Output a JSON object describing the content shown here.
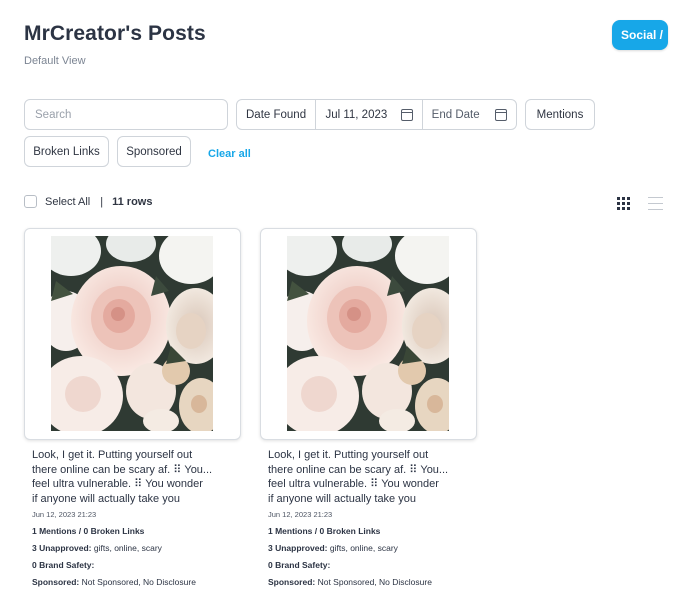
{
  "header": {
    "title": "MrCreator's Posts",
    "subtitle": "Default View",
    "social_button": "Social /"
  },
  "filters": {
    "search_placeholder": "Search",
    "date_found_label": "Date Found",
    "start_date": "Jul 11, 2023",
    "end_date_placeholder": "End Date",
    "mentions": "Mentions",
    "broken_links": "Broken Links",
    "sponsored": "Sponsored",
    "clear_all": "Clear all"
  },
  "selection": {
    "select_all": "Select All",
    "separator": "|",
    "rows": "11 rows"
  },
  "icons": {
    "grid": "grid-view-icon",
    "list": "list-view-icon",
    "calendar": "calendar-icon"
  },
  "posts": [
    {
      "caption_lines": [
        "Look, I get it. Putting yourself out",
        "there online can be scary af. ⠿ You...",
        "feel ultra vulnerable. ⠿ You wonder",
        "if anyone will actually take you"
      ],
      "date": "Jun 12, 2023 21:23",
      "mentions": "1 Mentions / 0 Broken Links",
      "unapproved_label": "3 Unapproved:",
      "unapproved_value": " gifts, online, scary",
      "brand_safety_label": "0 Brand Safety:",
      "sponsored_label": "Sponsored:",
      "sponsored_value": " Not Sponsored, No Disclosure"
    },
    {
      "caption_lines": [
        "Look, I get it. Putting yourself out",
        "there online can be scary af. ⠿ You...",
        "feel ultra vulnerable. ⠿ You wonder",
        "if anyone will actually take you"
      ],
      "date": "Jun 12, 2023 21:23",
      "mentions": "1 Mentions / 0 Broken Links",
      "unapproved_label": "3 Unapproved:",
      "unapproved_value": " gifts, online, scary",
      "brand_safety_label": "0 Brand Safety:",
      "sponsored_label": "Sponsored:",
      "sponsored_value": " Not Sponsored, No Disclosure"
    }
  ],
  "colors": {
    "accent": "#17a7e8",
    "title": "#2c3444",
    "border": "#cfd4da"
  }
}
